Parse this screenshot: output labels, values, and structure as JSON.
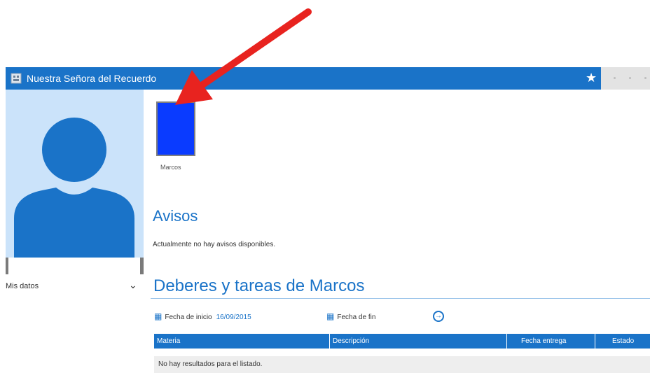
{
  "header": {
    "school_name": "Nuestra Señora del Recuerdo"
  },
  "sidebar": {
    "menu_label": "Mis datos"
  },
  "student": {
    "name": "Marcos"
  },
  "avisos": {
    "heading": "Avisos",
    "message": "Actualmente no hay avisos disponibles."
  },
  "deberes": {
    "heading": "Deberes y tareas de Marcos",
    "start_label": "Fecha de inicio",
    "start_value": "16/09/2015",
    "end_label": "Fecha de fin",
    "columns": [
      "Materia",
      "Descripción",
      "Fecha entrega",
      "Estado"
    ],
    "empty_message": "No hay resultados para el listado."
  },
  "colors": {
    "primary": "#1a73c8",
    "student_tile": "#0a3bff",
    "profile_bg": "#cbe3fa",
    "annotation_arrow": "#e8231f"
  }
}
